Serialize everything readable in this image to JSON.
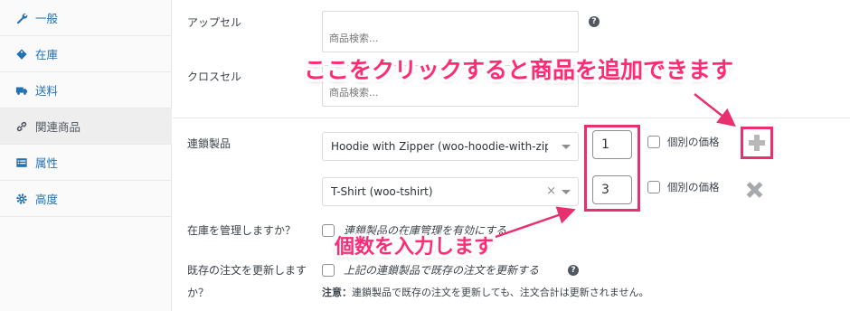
{
  "sidebar": {
    "items": [
      {
        "label": "一般",
        "icon": "wrench-icon"
      },
      {
        "label": "在庫",
        "icon": "tag-icon"
      },
      {
        "label": "送料",
        "icon": "truck-icon"
      },
      {
        "label": "関連商品",
        "icon": "link-icon",
        "active": true
      },
      {
        "label": "属性",
        "icon": "list-icon"
      },
      {
        "label": "高度",
        "icon": "gear-icon"
      }
    ]
  },
  "upsell": {
    "label": "アップセル",
    "placeholder": "商品検索..."
  },
  "crosssell": {
    "label": "クロスセル",
    "placeholder": "商品検索..."
  },
  "linked": {
    "label": "連鎖製品",
    "rows": [
      {
        "product": "Hoodie with Zipper (woo-hoodie-with-zip...",
        "qty": "1",
        "price_label": "個別の価格",
        "action": "add"
      },
      {
        "product": "T-Shirt (woo-tshirt)",
        "clear": "×",
        "qty": "3",
        "price_label": "個別の価格",
        "action": "remove"
      }
    ]
  },
  "manage_stock": {
    "label": "在庫を管理しますか？",
    "option": "連鎖製品の在庫管理を有効にする"
  },
  "update_orders": {
    "label_line1": "既存の注文を更新します",
    "label_line2": "か？",
    "option": "上記の連鎖製品で既存の注文を更新する",
    "note_bold": "注意：",
    "note_text": "連鎖製品で既存の注文を更新しても、注文合計は更新されません。"
  },
  "help_glyph": "?",
  "annotations": {
    "top": "ここをクリックすると商品を追加できます",
    "bottom": "個数を入力します"
  },
  "colors": {
    "accent": "#e8306e",
    "link": "#2271b1"
  }
}
